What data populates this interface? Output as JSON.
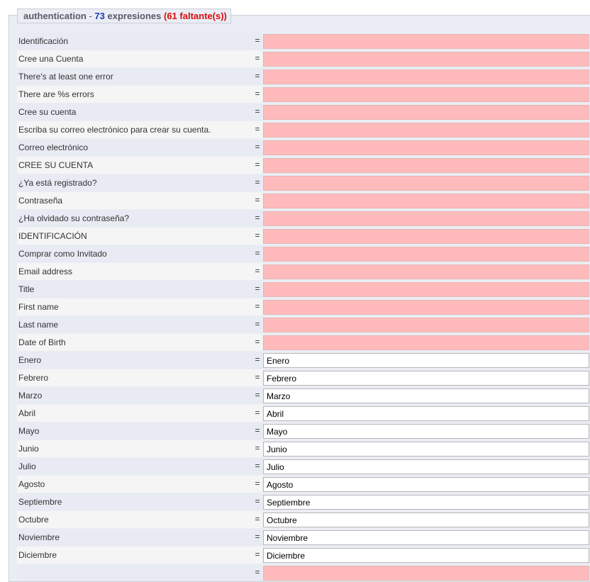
{
  "header": {
    "module": "authentication",
    "separator": " - ",
    "count": "73",
    "expressions_word": " expresiones ",
    "missing_open": "(",
    "missing": "61 faltante(s)",
    "missing_close": ")"
  },
  "equals": "=",
  "colors": {
    "missing_field_bg": "#ffbbbb",
    "count_blue": "#1a3cb8",
    "missing_red": "#db0a0a"
  },
  "rows": [
    {
      "label": "Identificación",
      "value": ""
    },
    {
      "label": "Cree una Cuenta",
      "value": ""
    },
    {
      "label": "There's at least one error",
      "value": ""
    },
    {
      "label": "There are %s errors",
      "value": ""
    },
    {
      "label": "Cree su cuenta",
      "value": ""
    },
    {
      "label": "Escriba su correo electrónico para crear su cuenta.",
      "value": ""
    },
    {
      "label": "Correo electrónico",
      "value": ""
    },
    {
      "label": "CREE SU CUENTA",
      "value": ""
    },
    {
      "label": "¿Ya está registrado?",
      "value": ""
    },
    {
      "label": "Contraseña",
      "value": ""
    },
    {
      "label": "¿Ha olvidado su contraseña?",
      "value": ""
    },
    {
      "label": "IDENTIFICACIÓN",
      "value": ""
    },
    {
      "label": "Comprar como Invitado",
      "value": ""
    },
    {
      "label": "Email address",
      "value": ""
    },
    {
      "label": "Title",
      "value": ""
    },
    {
      "label": "First name",
      "value": ""
    },
    {
      "label": "Last name",
      "value": ""
    },
    {
      "label": "Date of Birth",
      "value": ""
    },
    {
      "label": "Enero",
      "value": "Enero"
    },
    {
      "label": "Febrero",
      "value": "Febrero"
    },
    {
      "label": "Marzo",
      "value": "Marzo"
    },
    {
      "label": "Abril",
      "value": "Abril"
    },
    {
      "label": "Mayo",
      "value": "Mayo"
    },
    {
      "label": "Junio",
      "value": "Junio"
    },
    {
      "label": "Julio",
      "value": "Julio"
    },
    {
      "label": "Agosto",
      "value": "Agosto"
    },
    {
      "label": "Septiembre",
      "value": "Septiembre"
    },
    {
      "label": "Octubre",
      "value": "Octubre"
    },
    {
      "label": "Noviembre",
      "value": "Noviembre"
    },
    {
      "label": "Diciembre",
      "value": "Diciembre"
    },
    {
      "label": "",
      "value": ""
    }
  ]
}
